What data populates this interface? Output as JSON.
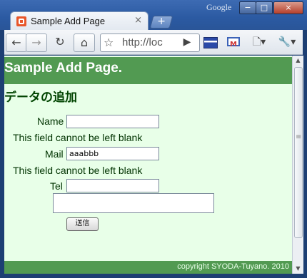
{
  "browser": {
    "tab_title": "Sample Add Page",
    "tab_close": "×",
    "new_tab": "+",
    "google_label": "Google",
    "window_minimize": "−",
    "window_maximize": "□",
    "window_close": "×",
    "address_text": "http://loc",
    "icons": {
      "back": "←",
      "forward": "→",
      "reload": "↻",
      "home": "⌂",
      "star": "☆",
      "go": "▶",
      "page_menu": "🗋▾",
      "wrench_menu": "🔧▾"
    }
  },
  "page": {
    "header_title": "Sample Add Page.",
    "section_title": "データの追加",
    "form": {
      "name_label": "Name",
      "name_value": "",
      "name_error": "This field cannot be left blank",
      "mail_label": "Mail",
      "mail_value": "aaabbb",
      "mail_error": "This field cannot be left blank",
      "tel_label": "Tel",
      "tel_value": "",
      "textarea_value": "",
      "submit_label": "送信"
    },
    "footer_text": "copyright SYODA-Tuyano. 2010"
  },
  "scrollbar": {
    "up": "▲",
    "down": "▼"
  },
  "colors": {
    "header_green": "#529a52",
    "page_background": "#e8ffe8",
    "heading_text": "#004400"
  }
}
